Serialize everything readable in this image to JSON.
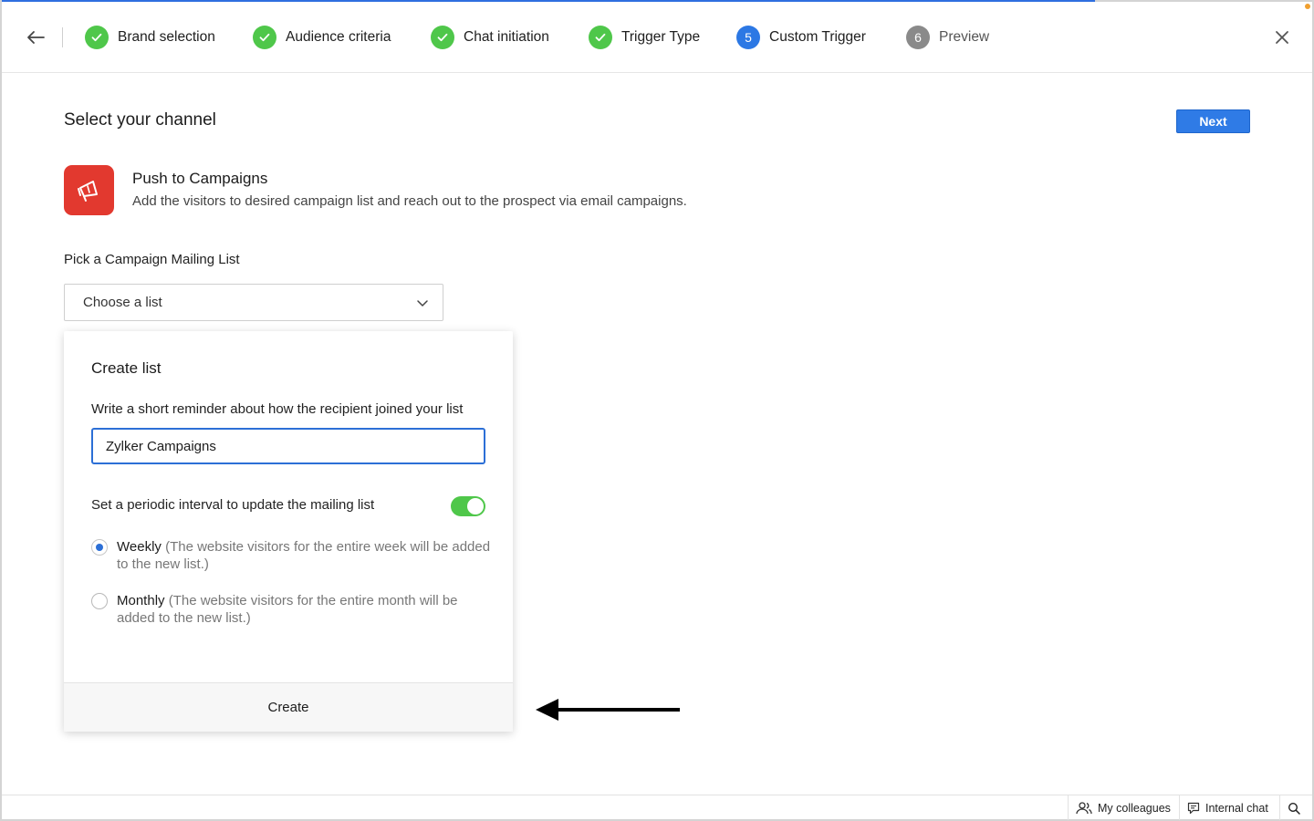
{
  "steps": [
    {
      "number": "1",
      "label": "Brand selection",
      "status": "done"
    },
    {
      "number": "2",
      "label": "Audience criteria",
      "status": "done"
    },
    {
      "number": "3",
      "label": "Chat initiation",
      "status": "done"
    },
    {
      "number": "4",
      "label": "Trigger Type",
      "status": "done"
    },
    {
      "number": "5",
      "label": "Custom Trigger",
      "status": "active"
    },
    {
      "number": "6",
      "label": "Preview",
      "status": "todo"
    }
  ],
  "page": {
    "title": "Select your channel",
    "next_label": "Next"
  },
  "channel": {
    "name": "Push to Campaigns",
    "description": "Add the visitors to desired campaign list and reach out to the prospect via email campaigns.",
    "icon": "megaphone-icon",
    "icon_color": "#e2392f"
  },
  "mailing_list": {
    "label": "Pick a Campaign Mailing List",
    "placeholder": "Choose a list"
  },
  "create_list": {
    "title": "Create list",
    "help_text": "Write a short reminder about how the recipient joined your list",
    "input_value": "Zylker Campaigns",
    "toggle_label": "Set a periodic interval to update the mailing list",
    "toggle_on": true,
    "options": [
      {
        "label": "Weekly",
        "detail": "(The website visitors for the entire week will be added to the new list.)",
        "checked": true
      },
      {
        "label": "Monthly",
        "detail": "(The website visitors for the entire month will be added to the new list.)",
        "checked": false
      }
    ],
    "create_label": "Create"
  },
  "bottom_bar": {
    "colleagues_label": "My colleagues",
    "chat_label": "Internal chat"
  },
  "colors": {
    "accent": "#2f7be6",
    "done": "#4fc74a",
    "toggle": "#4fc74a"
  }
}
